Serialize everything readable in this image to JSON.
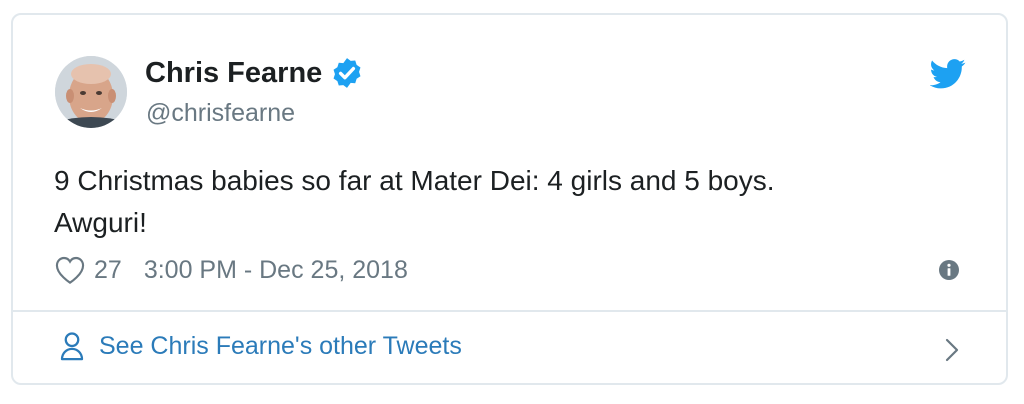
{
  "tweet": {
    "author_name": "Chris Fearne",
    "handle": "@chrisfearne",
    "text_line1": "9 Christmas babies so far at Mater Dei: 4 girls and 5 boys.",
    "text_line2": "Awguri!",
    "like_count": "27",
    "timestamp": "3:00 PM - Dec 25, 2018"
  },
  "footer": {
    "link_label": "See Chris Fearne's other Tweets"
  },
  "icons": {
    "verified": "verified-badge-icon",
    "brand": "twitter-bird-icon",
    "like": "heart-icon",
    "info": "info-icon",
    "profile": "person-icon",
    "more": "chevron-right-icon"
  },
  "colors": {
    "text": "#1c2022",
    "muted": "#697882",
    "link": "#2b7bb9",
    "brand_blue": "#1da1f2",
    "border": "#e1e8ed"
  }
}
